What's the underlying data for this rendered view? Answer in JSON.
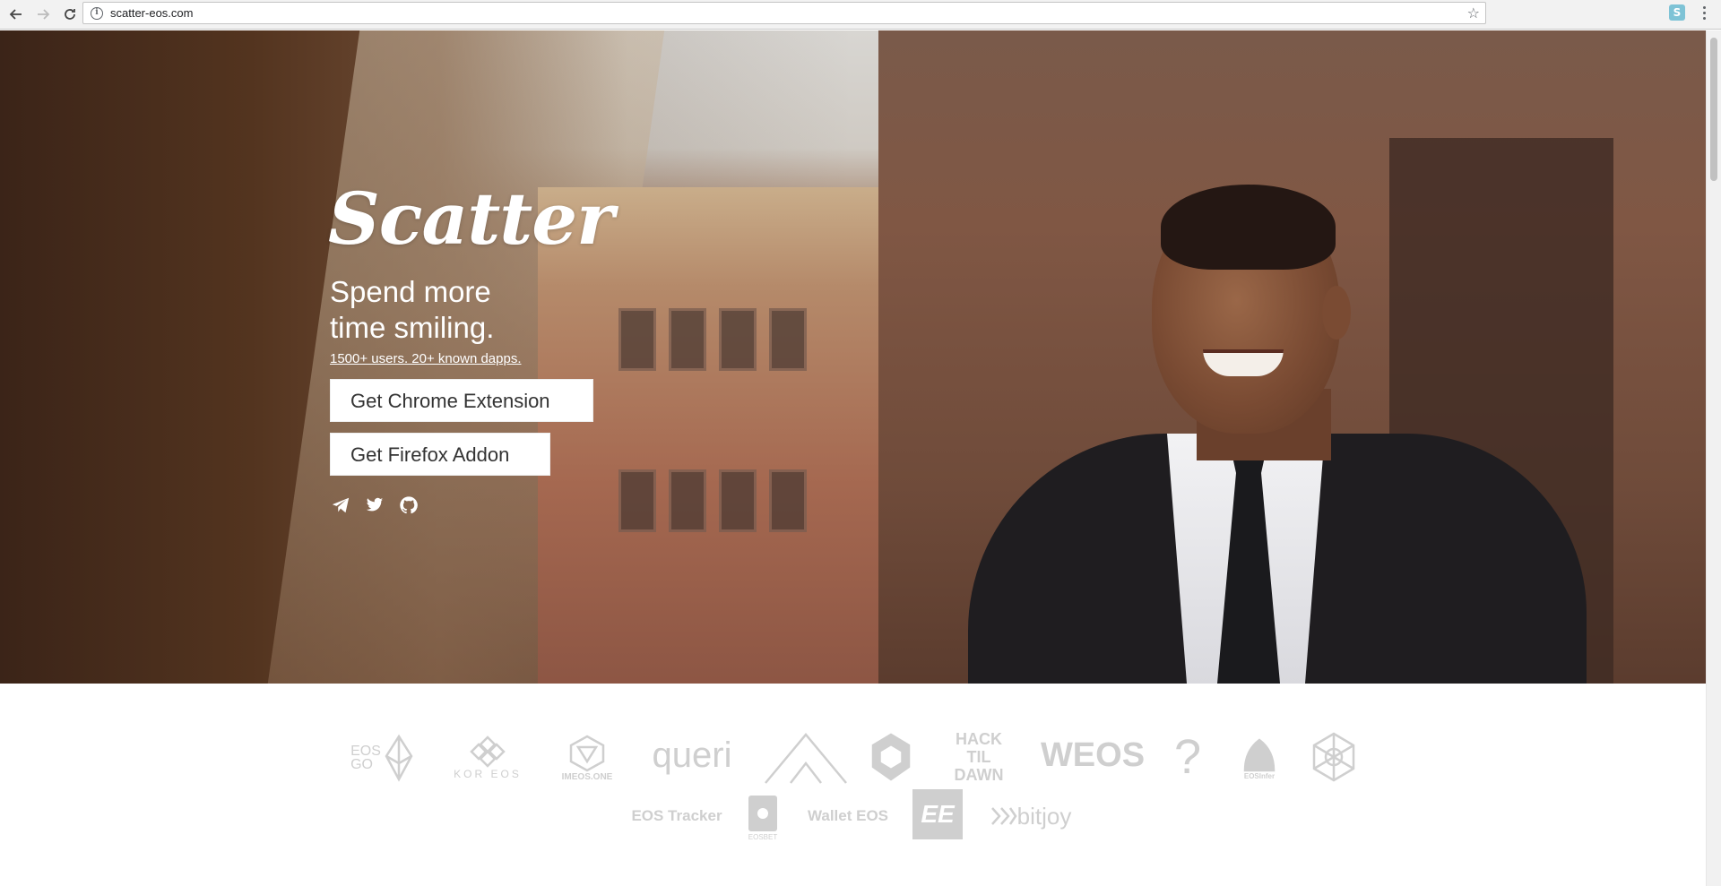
{
  "browser": {
    "url": "scatter-eos.com"
  },
  "hero": {
    "brand": "Scatter",
    "tagline_line1": "Spend more",
    "tagline_line2": "time smiling.",
    "stats": "1500+ users. 20+ known dapps.",
    "chrome_button": "Get Chrome Extension",
    "firefox_button": "Get Firefox Addon",
    "social_icons": [
      "telegram-icon",
      "twitter-icon",
      "github-icon"
    ]
  },
  "partners": {
    "row1": [
      {
        "name": "EOS GO",
        "label": "EOS\nGO"
      },
      {
        "name": "KOREOS",
        "label": "KOR EOS"
      },
      {
        "name": "IMEOS.ONE",
        "label": "IMEOS.ONE"
      },
      {
        "name": "queri",
        "label": "queri"
      },
      {
        "name": "mountain-logo",
        "label": ""
      },
      {
        "name": "hex-logo",
        "label": ""
      },
      {
        "name": "HACK TIL DAWN",
        "label": "HACK TIL DAWN"
      },
      {
        "name": "WEOS",
        "label": "WEOS"
      },
      {
        "name": "question-logo",
        "label": "?"
      },
      {
        "name": "EOSInfer",
        "label": "EOSInfer"
      },
      {
        "name": "network-logo",
        "label": ""
      }
    ],
    "row2": [
      {
        "name": "EOS Tracker",
        "label": "EOS Tracker"
      },
      {
        "name": "EOSBET",
        "label": "EOSBET"
      },
      {
        "name": "Wallet EOS",
        "label": "Wallet EOS"
      },
      {
        "name": "EE",
        "label": "EE"
      },
      {
        "name": "bitjoy",
        "label": "bitjoy"
      }
    ]
  }
}
